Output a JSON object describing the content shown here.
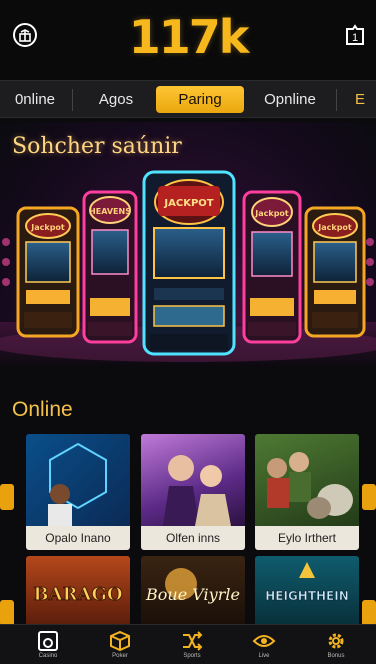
{
  "header": {
    "logo": "117k",
    "left_icon": "gift-icon",
    "right_icon": "notification-icon",
    "right_badge": "1"
  },
  "tabs": [
    {
      "label": "0nline",
      "active": false
    },
    {
      "label": "Agos",
      "active": false
    },
    {
      "label": "Paring",
      "active": true
    },
    {
      "label": "Opnline",
      "active": false
    },
    {
      "label": "E",
      "active": false
    }
  ],
  "banner": {
    "title": "Sohcher saúnir",
    "machine_titles": [
      "Jackpot",
      "HEAVENS",
      "JACKPOT",
      "Jackpot",
      "Jackpot"
    ]
  },
  "section": {
    "title": "Online"
  },
  "games": [
    {
      "label": "Opalo Inano"
    },
    {
      "label": "Olfen inns"
    },
    {
      "label": "Eylo Irthert"
    },
    {
      "label": "BARAGO"
    },
    {
      "label": "Boue Viyrle"
    },
    {
      "label": "HEIGHTHEIN"
    }
  ],
  "bottom_nav": [
    {
      "label": "Casino",
      "icon": "casino-icon"
    },
    {
      "label": "Poker",
      "icon": "cube-icon"
    },
    {
      "label": "Sports",
      "icon": "shuffle-icon"
    },
    {
      "label": "Live",
      "icon": "eye-icon"
    },
    {
      "label": "Bonus",
      "icon": "settings-gear-icon"
    }
  ],
  "colors": {
    "accent": "#f6b81c",
    "background": "#0b0b0d",
    "tab_bar": "#1d1d20"
  }
}
